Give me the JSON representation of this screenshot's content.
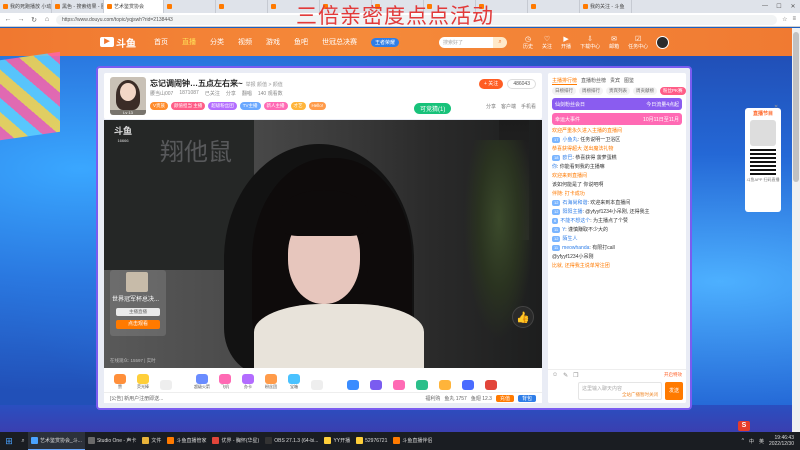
{
  "browser": {
    "tabs": [
      {
        "label": "我的死跑播放 小动无线和接...",
        "active": false
      },
      {
        "label": "黑色 - 搜索结果 - 图片...",
        "active": false
      },
      {
        "label": "艺术鉴赏协会",
        "active": true
      },
      {
        "label": "",
        "active": false
      },
      {
        "label": "",
        "active": false
      },
      {
        "label": "",
        "active": false
      },
      {
        "label": "",
        "active": false
      },
      {
        "label": "",
        "active": false
      },
      {
        "label": "",
        "active": false
      },
      {
        "label": "",
        "active": false
      },
      {
        "label": "",
        "active": false
      },
      {
        "label": "我的关注 - 斗鱼",
        "active": false
      }
    ],
    "url": "https://www.douyu.com/topic/yqjswh?rid=2138443"
  },
  "overlay_title": "三倍亲密度点点活动",
  "header": {
    "logo": "斗鱼",
    "nav": [
      {
        "label": "首页",
        "current": false
      },
      {
        "label": "直播",
        "current": true
      },
      {
        "label": "分类",
        "current": false
      },
      {
        "label": "视频",
        "current": false
      },
      {
        "label": "游戏",
        "current": false
      },
      {
        "label": "鱼吧",
        "current": false
      },
      {
        "label": "世冠总决赛",
        "current": false
      }
    ],
    "badge": "王者荣耀",
    "search_placeholder": "搜索好了",
    "user_menu": [
      "历史",
      "关注",
      "开播",
      "下载中心",
      "邮箱",
      "任务中心"
    ]
  },
  "room": {
    "title": "忘记调闹钟…五点左右来~",
    "title_sub": "举报  颜值 > 颜值",
    "meta": [
      "腰当山007",
      "1871087",
      "已关注",
      "分享",
      "翻唱",
      "140 观看数"
    ],
    "level": "13",
    "tags": [
      {
        "label": "V贵族",
        "color": "#ff8c2b"
      },
      {
        "label": "颜值担当 主播",
        "color": "#ff5d87"
      },
      {
        "label": "超级粉丝团",
        "color": "#b36cff"
      },
      {
        "label": "TV主播",
        "color": "#6aa8ff"
      },
      {
        "label": "新人主播",
        "color": "#ff6ab4"
      },
      {
        "label": "才艺",
        "color": "#ffb43a"
      },
      {
        "label": "Hello!",
        "color": "#ff9b4a"
      }
    ],
    "follow_label": "+ 关注",
    "follower_count": "486043",
    "game_label": "可竞猜(1)",
    "actions": [
      "分享",
      "客户端",
      "手机看"
    ]
  },
  "video": {
    "board_text": "翔他鼠",
    "logo": "斗鱼",
    "room_id": "16666",
    "stats": "在线观众: 15597 |  实时",
    "promo": {
      "title": "世界冠军杯总决...",
      "btn1": "主播直播",
      "btn2": "点击观看"
    }
  },
  "gifts": [
    {
      "label": "赞",
      "color": "#ff8f3a"
    },
    {
      "label": "荧光棒",
      "color": "#ffcf3a"
    },
    {
      "label": "",
      "color": "#eee"
    },
    {
      "label": "超级火箭",
      "color": "#6a8cff"
    },
    {
      "label": "飞机",
      "color": "#ff6ab4"
    },
    {
      "label": "办卡",
      "color": "#b36cff"
    },
    {
      "label": "粉丝团",
      "color": "#ff9b4a"
    },
    {
      "label": "宝箱",
      "color": "#4ac2ff"
    },
    {
      "label": "",
      "color": "#eee"
    },
    {
      "label": "",
      "color": "#3a8cff"
    },
    {
      "label": "",
      "color": "#7a5cf0"
    },
    {
      "label": "",
      "color": "#ff6ab4"
    },
    {
      "label": "",
      "color": "#2bbf8a"
    },
    {
      "label": "",
      "color": "#ffb43a"
    },
    {
      "label": "",
      "color": "#4a6cff"
    },
    {
      "label": "",
      "color": "#e2453a"
    }
  ],
  "bottom_bar": {
    "left": "[公告] 新用户注册即送...",
    "right": [
      "福利购",
      "鱼丸 1757",
      "鱼翅 12.3"
    ],
    "recharge": "充值",
    "pack": "背包"
  },
  "chat": {
    "tabs": [
      "主播排行榜",
      "直播粉丝榜",
      "贵宾",
      "图鉴"
    ],
    "subtabs": [
      "日榜排行",
      "周榜排行",
      "贵宾列表",
      "周贡献榜",
      "粉丝PK赛"
    ],
    "notices": [
      {
        "label": "仙剑粉丝会日",
        "extra": "今日流量4点起",
        "color": "#8a5cf0"
      },
      {
        "label": "幸运大事件",
        "extra": "10月11日至11月",
        "color": "#ff6ab4"
      }
    ],
    "messages": [
      {
        "lv": "",
        "nick": "",
        "text": "欢迎严重永久进入主播的直播间",
        "type": "sys"
      },
      {
        "lv": "17",
        "nick": "小鱼丸",
        "text": "任务说明一卫浴区",
        "type": "normal"
      },
      {
        "lv": "",
        "nick": "",
        "text": "恭喜获得超大 送出魔法礼物",
        "type": "sys"
      },
      {
        "lv": "18",
        "nick": "欧巴",
        "text": "恭喜获得 菠萝蛋糕",
        "type": "normal"
      },
      {
        "lv": "",
        "nick": "你",
        "text": "你能看到我的主播嘛",
        "type": "normal"
      },
      {
        "lv": "",
        "nick": "",
        "text": "欢迎来到直播间",
        "type": "sys"
      },
      {
        "lv": "",
        "nick": "",
        "text": "该如何能是了 你说吧啊",
        "type": "normal"
      },
      {
        "lv": "",
        "nick": "",
        "text": "伴随: 打卡成功",
        "type": "sys"
      },
      {
        "lv": "12",
        "nick": "石海尚和谐",
        "text": "欢迎来到本直播间",
        "type": "normal"
      },
      {
        "lv": "12",
        "nick": "阳阳主播",
        "text": "@yfyyf1234小吊刚, 还得我主",
        "type": "normal"
      },
      {
        "lv": "6",
        "nick": "不能不想这个",
        "text": "为主播点了个赞",
        "type": "normal"
      },
      {
        "lv": "11",
        "nick": "Y",
        "text": "谨慎赚取不少大的",
        "type": "normal"
      },
      {
        "lv": "12",
        "nick": "陌生人",
        "text": "",
        "type": "normal"
      },
      {
        "lv": "11",
        "nick": "meowhanda",
        "text": "有限打call",
        "type": "normal"
      },
      {
        "lv": "",
        "nick": "",
        "text": "@yfyyf1234小吊刚",
        "type": "normal"
      },
      {
        "lv": "",
        "nick": "",
        "text": "比就, 还得我主说单常注团",
        "type": "sys"
      }
    ],
    "tools": [
      "表情",
      "弹幕",
      "礼物"
    ],
    "switch": "开启特效",
    "input_placeholder": "这里输入聊天内容",
    "input_hint": "全站广播暂时关闭",
    "send": "发送"
  },
  "float_card": {
    "title": "直播节目",
    "caption": "斗鱼APP 扫码直播"
  },
  "taskbar": {
    "items": [
      {
        "label": "艺术鉴赏协会_斗...",
        "color": "#4aa3ff",
        "active": true
      },
      {
        "label": "Studio One - 声卡",
        "color": "#6a6a6a",
        "active": false
      },
      {
        "label": "文件",
        "color": "#e8b33a",
        "active": false
      },
      {
        "label": "斗鱼直播管家",
        "color": "#ff7a00",
        "active": false
      },
      {
        "label": "优界 - 胸怀(华星)",
        "color": "#e2453a",
        "active": false
      },
      {
        "label": "OBS 27.1.3 (64-bi...",
        "color": "#333",
        "active": false
      },
      {
        "label": "YY开播",
        "color": "#ffcf3a",
        "active": false
      },
      {
        "label": "52976721",
        "color": "#ffcf3a",
        "active": false
      },
      {
        "label": "斗鱼直播伴侣",
        "color": "#ff7a00",
        "active": false
      }
    ],
    "tray": [
      "^",
      "中",
      "英"
    ],
    "time": "19:46:43",
    "date": "2022/12/30"
  },
  "colors": {
    "brand": "#f07830",
    "accent_purple": "#7a5cf0",
    "page_bg": "#2150b8"
  }
}
